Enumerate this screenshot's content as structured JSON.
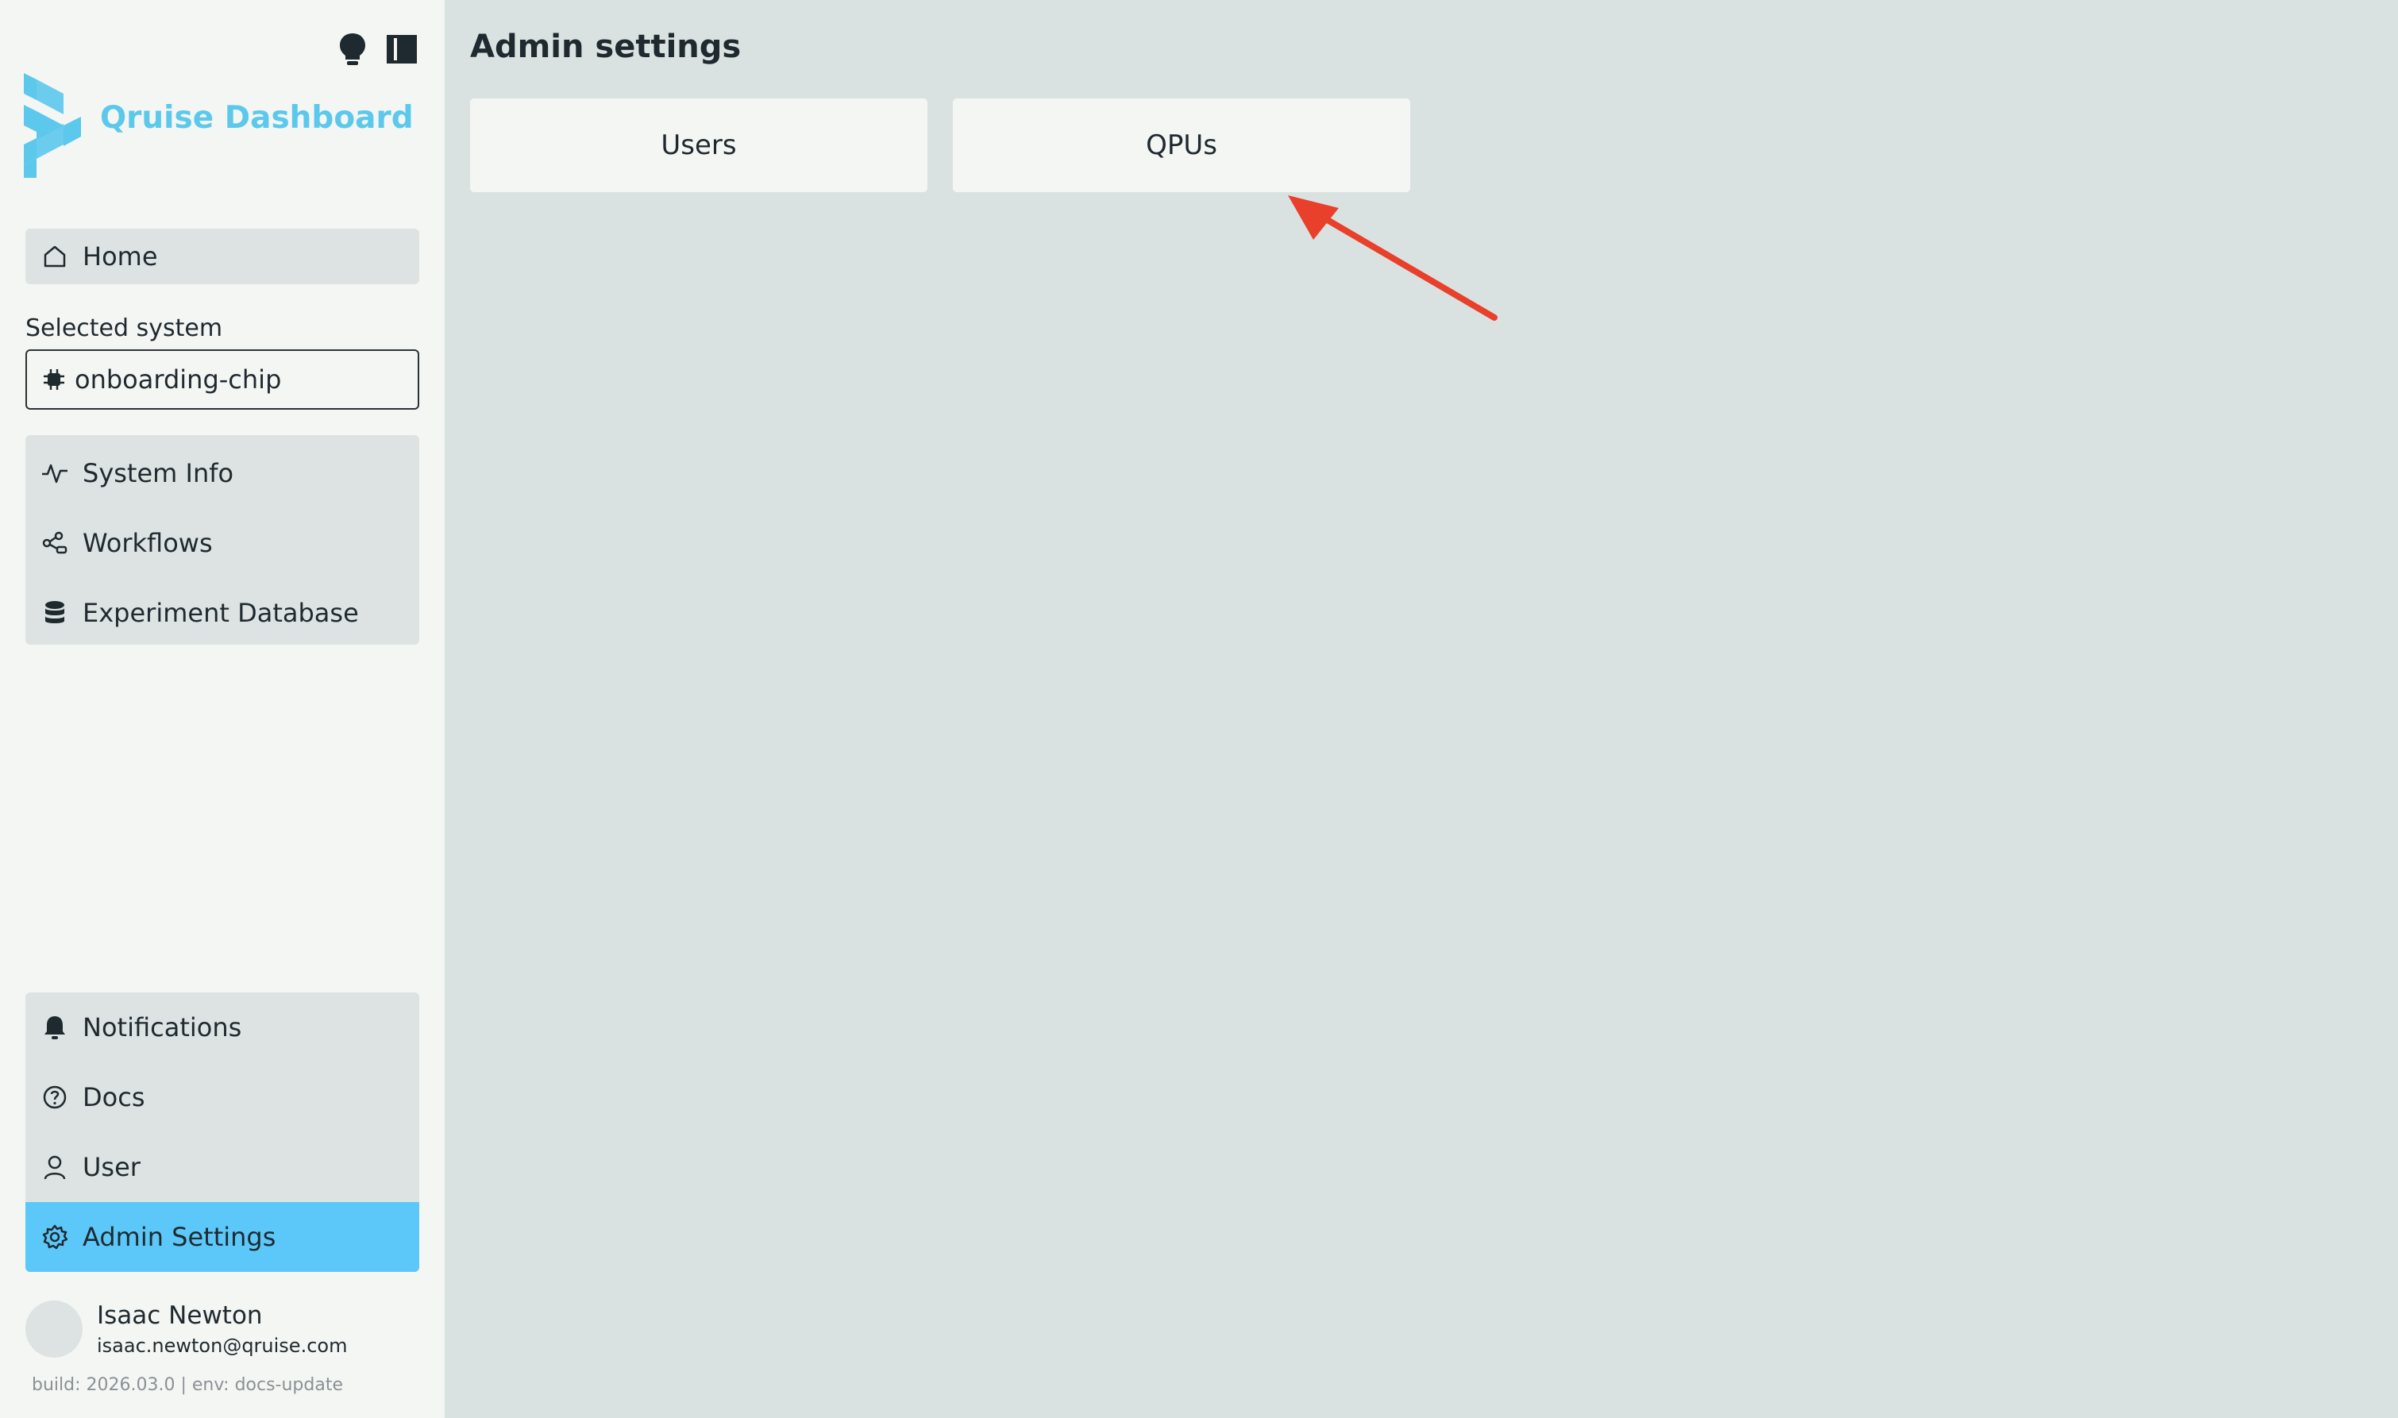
{
  "sidebar": {
    "brand_title": "Qruise Dashboard",
    "home_label": "Home",
    "selected_system_label": "Selected system",
    "selected_system_value": "onboarding-chip",
    "system_items": [
      {
        "label": "System Info",
        "icon": "activity-icon"
      },
      {
        "label": "Workflows",
        "icon": "workflow-icon"
      },
      {
        "label": "Experiment Database",
        "icon": "database-icon"
      }
    ],
    "bottom_items": [
      {
        "label": "Notifications",
        "icon": "bell-icon"
      },
      {
        "label": "Docs",
        "icon": "help-circle-icon"
      },
      {
        "label": "User",
        "icon": "user-icon"
      },
      {
        "label": "Admin Settings",
        "icon": "gear-icon",
        "active": true
      }
    ],
    "user": {
      "name": "Isaac Newton",
      "email": "isaac.newton@qruise.com"
    },
    "build_info": "build: 2026.03.0 | env: docs-update"
  },
  "main": {
    "title": "Admin settings",
    "cards": [
      {
        "label": "Users"
      },
      {
        "label": "QPUs"
      }
    ]
  },
  "colors": {
    "accent": "#5cc8fa",
    "brand": "#5cc8ec",
    "annotation_arrow": "#e8402a",
    "sidebar_bg": "#f4f6f3",
    "main_bg": "#dae2e1"
  }
}
